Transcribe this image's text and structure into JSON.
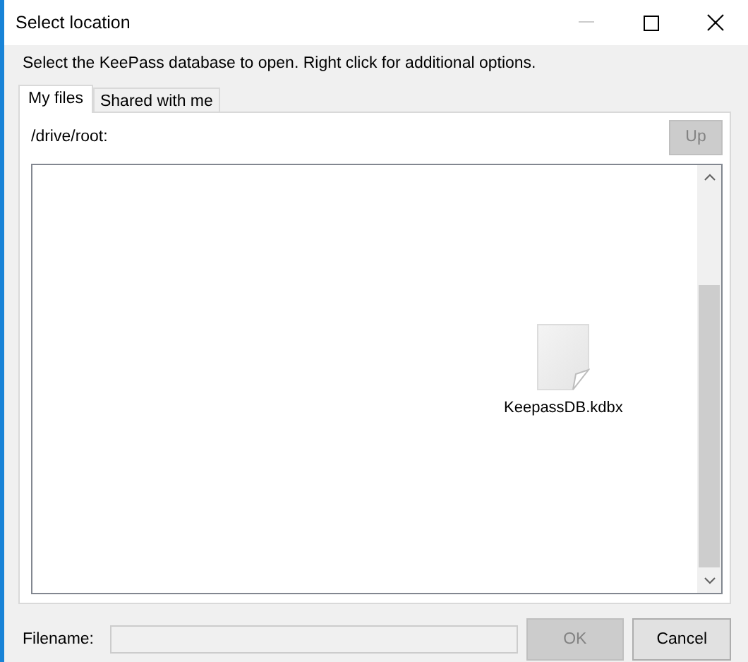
{
  "window": {
    "title": "Select location"
  },
  "instruction": "Select the KeePass database to open. Right click for additional options.",
  "tabs": [
    {
      "label": "My files",
      "selected": true
    },
    {
      "label": "Shared with me",
      "selected": false
    }
  ],
  "path": "/drive/root:",
  "up_button": {
    "label": "Up",
    "disabled": true
  },
  "files": [
    {
      "name": "KeepassDB.kdbx"
    }
  ],
  "filename": {
    "label": "Filename:",
    "disabled": true
  },
  "buttons": [
    {
      "label": "OK",
      "disabled": true
    },
    {
      "label": "Cancel",
      "disabled": false
    }
  ]
}
